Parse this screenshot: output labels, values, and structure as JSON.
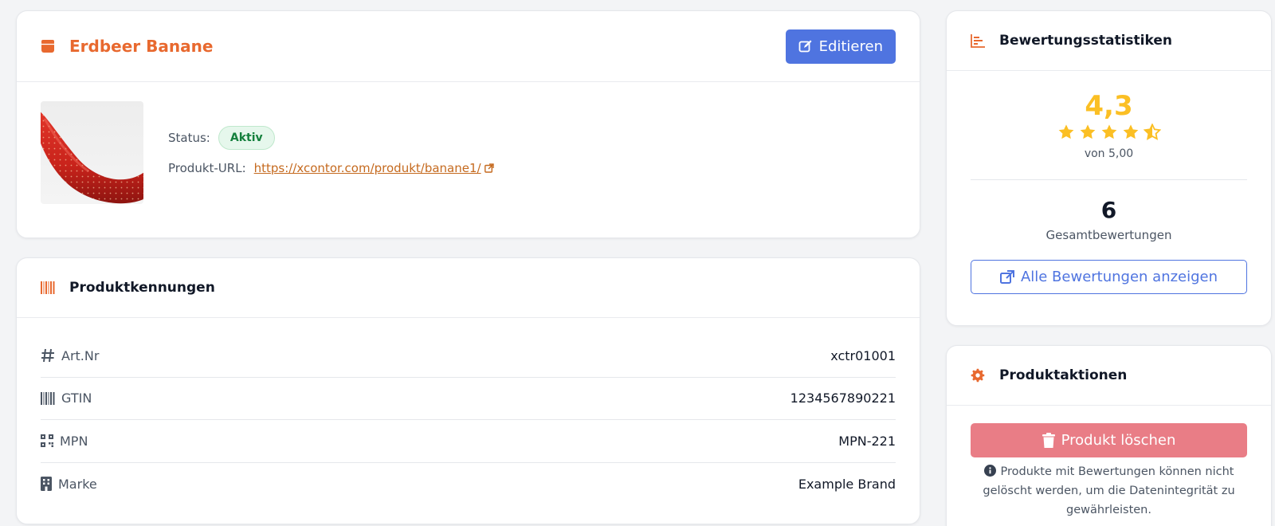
{
  "product": {
    "title": "Erdbeer Banane",
    "edit_label": "Editieren",
    "status_label": "Status:",
    "status_value": "Aktiv",
    "url_label": "Produkt-URL:",
    "url_value": "https://xcontor.com/produkt/banane1/",
    "image_alt": "Erdbeer Banane"
  },
  "identifiers": {
    "title": "Produktkennungen",
    "rows": [
      {
        "icon": "hash-icon",
        "label": "Art.Nr",
        "value": "xctr01001"
      },
      {
        "icon": "barcode-icon",
        "label": "GTIN",
        "value": "1234567890221"
      },
      {
        "icon": "qrcode-icon",
        "label": "MPN",
        "value": "MPN-221"
      },
      {
        "icon": "building-icon",
        "label": "Marke",
        "value": "Example Brand"
      }
    ]
  },
  "stats": {
    "title": "Bewertungsstatistiken",
    "average": "4,3",
    "average_numeric": 4.3,
    "out_of": "von 5,00",
    "total": "6",
    "total_label": "Gesamtbewertungen",
    "view_all_label": "Alle Bewertungen anzeigen"
  },
  "actions": {
    "title": "Produktaktionen",
    "delete_label": "Produkt löschen",
    "hint": "Produkte mit Bewertungen können nicht gelöscht werden, um die Datenintegrität zu gewährleisten."
  },
  "colors": {
    "accent": "#e8692f",
    "primary": "#4f74e0",
    "star": "#fbbf24",
    "danger_disabled": "#e97d86",
    "success": "#15803d"
  }
}
